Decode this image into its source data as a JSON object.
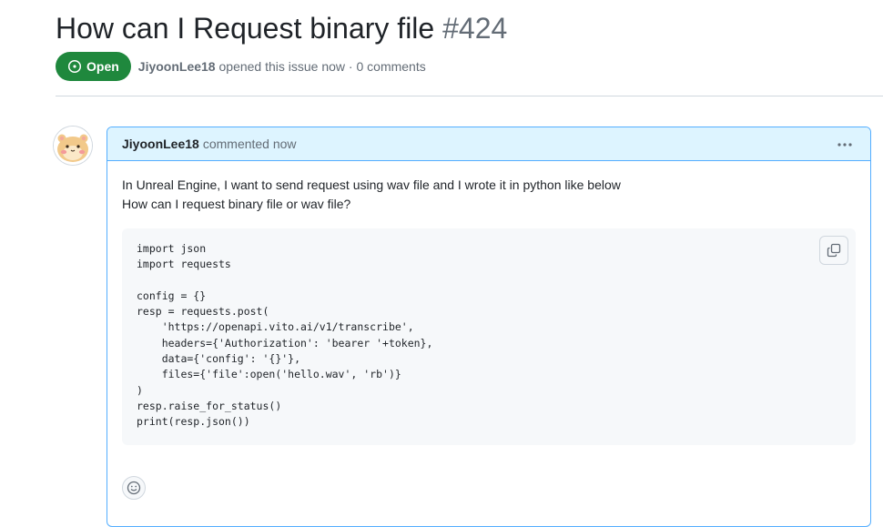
{
  "issue": {
    "title": "How can I Request binary file",
    "number": "#424",
    "state": "Open",
    "author": "JiyoonLee18",
    "meta_suffix": " opened this issue now · 0 comments"
  },
  "comment": {
    "author": "JiyoonLee18",
    "time": "commented now",
    "paragraph_1": "In Unreal Engine, I want to send request using wav file and I wrote it in python like below",
    "paragraph_2": "How can I request binary file or wav file?",
    "code": "import json\nimport requests\n\nconfig = {}\nresp = requests.post(\n    'https://openapi.vito.ai/v1/transcribe',\n    headers={'Authorization': 'bearer '+token},\n    data={'config': '{}'},\n    files={'file':open('hello.wav', 'rb')}\n)\nresp.raise_for_status()\nprint(resp.json())"
  },
  "icons": {
    "state": "issue-opened-icon",
    "menu": "kebab-horizontal-icon",
    "copy": "copy-icon",
    "reaction": "smiley-icon",
    "avatar": "hamster-avatar"
  },
  "colors": {
    "open_green": "#1f883d",
    "header_blue": "#ddf4ff",
    "border_blue": "#54aeff",
    "muted_text": "#636c76"
  }
}
